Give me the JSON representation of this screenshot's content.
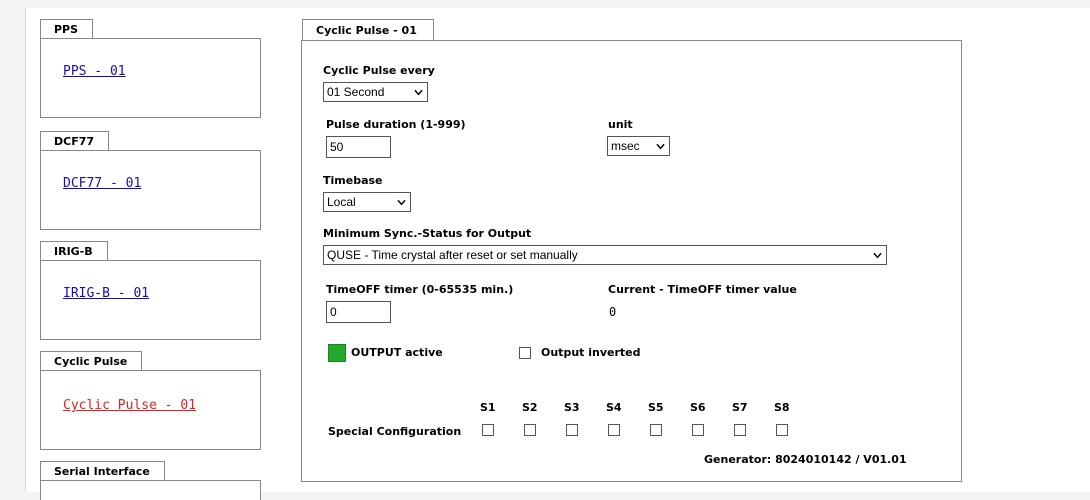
{
  "sidebar": {
    "groups": [
      {
        "tab": "PPS",
        "link": "PPS - 01"
      },
      {
        "tab": "DCF77",
        "link": "DCF77 - 01"
      },
      {
        "tab": "IRIG-B",
        "link": "IRIG-B - 01"
      },
      {
        "tab": "Cyclic Pulse",
        "link": "Cyclic Pulse - 01"
      },
      {
        "tab": "Serial Interface"
      }
    ]
  },
  "panel": {
    "tab": "Cyclic Pulse - 01",
    "cyclic_label": "Cyclic Pulse every",
    "cyclic_value": "01 Second",
    "duration_label": "Pulse duration (1-999)",
    "duration_value": "50",
    "unit_label": "unit",
    "unit_value": "msec",
    "timebase_label": "Timebase",
    "timebase_value": "Local",
    "sync_label": "Minimum Sync.-Status for Output",
    "sync_value": "QUSE - Time crystal after reset or set manually",
    "timeoff_label": "TimeOFF timer (0-65535 min.)",
    "timeoff_value": "0",
    "current_label": "Current - TimeOFF timer value",
    "current_value": "0",
    "output_active_label": "OUTPUT active",
    "output_inverted_label": "Output inverted",
    "special_label": "Special Configuration",
    "switches": [
      "S1",
      "S2",
      "S3",
      "S4",
      "S5",
      "S6",
      "S7",
      "S8"
    ],
    "generator": "Generator: 8024010142 / V01.01"
  },
  "colors": {
    "link": "#1a0dab",
    "active_link": "#e02020",
    "output_active": "#22a82a"
  }
}
